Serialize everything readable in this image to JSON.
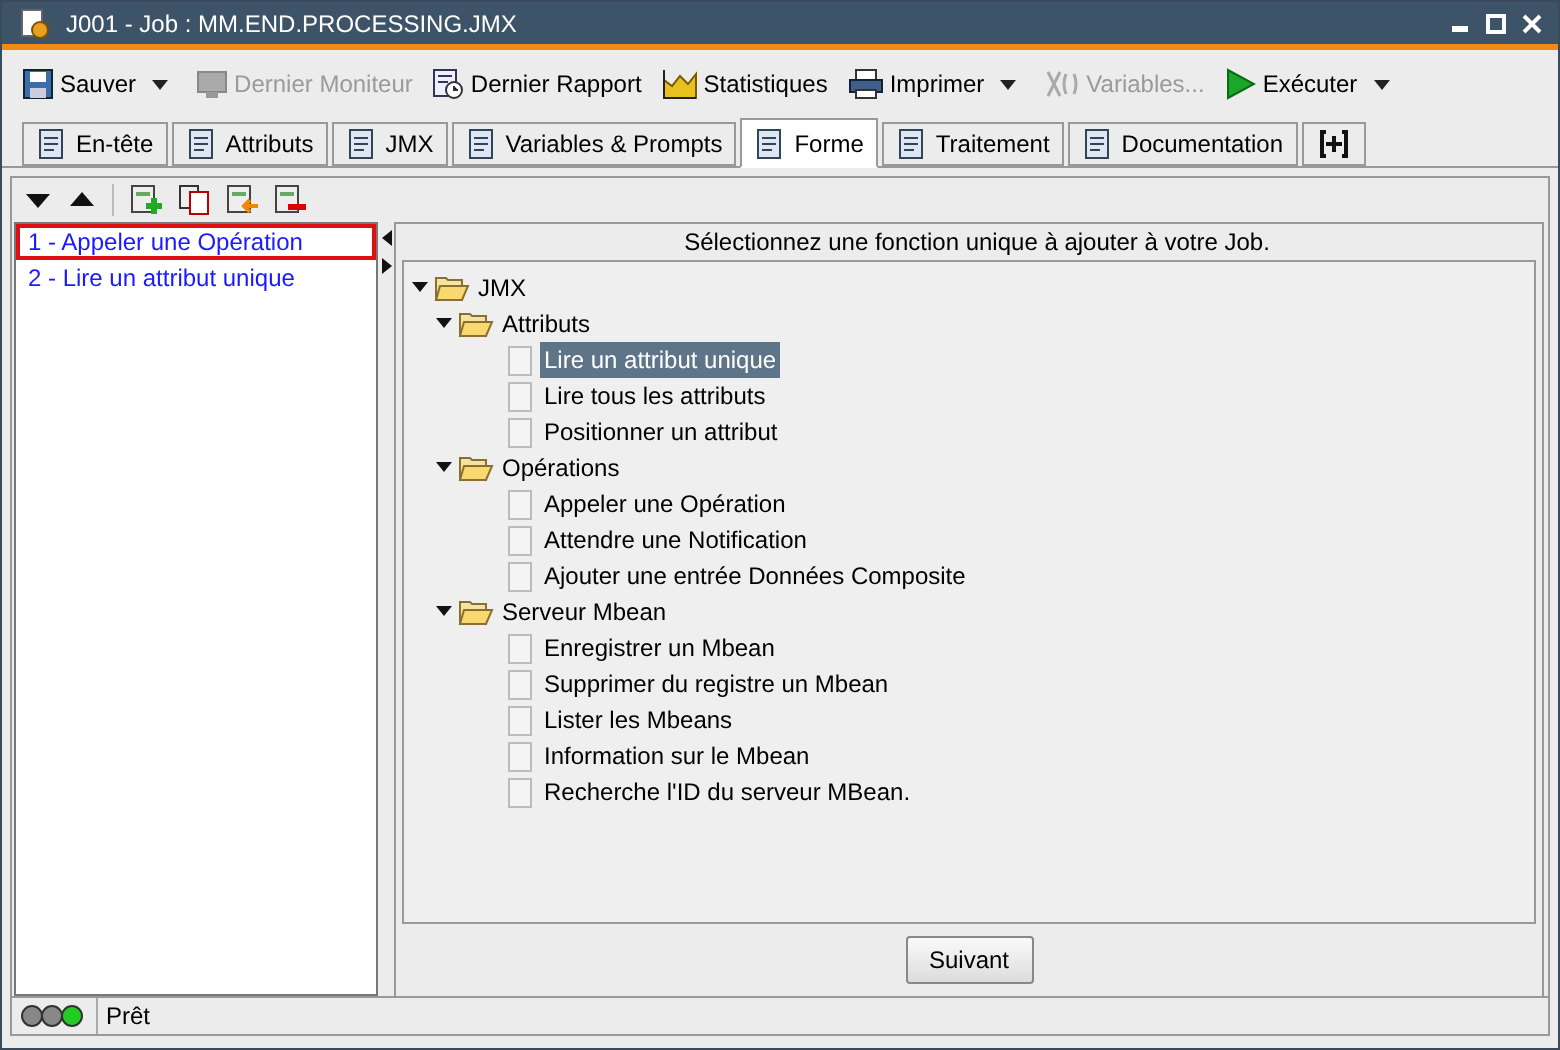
{
  "window": {
    "title": "J001 - Job : MM.END.PROCESSING.JMX"
  },
  "toolbar": [
    {
      "label": "Sauver",
      "disabled": false,
      "dropdown": true
    },
    {
      "label": "Dernier Moniteur",
      "disabled": true,
      "dropdown": false
    },
    {
      "label": "Dernier Rapport",
      "disabled": false,
      "dropdown": false
    },
    {
      "label": "Statistiques",
      "disabled": false,
      "dropdown": false
    },
    {
      "label": "Imprimer",
      "disabled": false,
      "dropdown": true
    },
    {
      "label": "Variables...",
      "disabled": true,
      "dropdown": false
    },
    {
      "label": "Exécuter",
      "disabled": false,
      "dropdown": true
    }
  ],
  "tabs": [
    {
      "label": "En-tête",
      "selected": false
    },
    {
      "label": "Attributs",
      "selected": false
    },
    {
      "label": "JMX",
      "selected": false
    },
    {
      "label": "Variables & Prompts",
      "selected": false
    },
    {
      "label": "Forme",
      "selected": true
    },
    {
      "label": "Traitement",
      "selected": false
    },
    {
      "label": "Documentation",
      "selected": false
    }
  ],
  "steps": [
    {
      "label": "1 - Appeler une Opération",
      "selected": true
    },
    {
      "label": "2 - Lire un attribut unique",
      "selected": false
    }
  ],
  "prompt": "Sélectionnez une fonction unique à ajouter à votre Job.",
  "tree": {
    "label": "JMX",
    "expanded": true,
    "children": [
      {
        "label": "Attributs",
        "expanded": true,
        "children": [
          {
            "label": "Lire un attribut unique",
            "selected": true
          },
          {
            "label": "Lire tous les attributs",
            "selected": false
          },
          {
            "label": "Positionner un attribut",
            "selected": false
          }
        ]
      },
      {
        "label": "Opérations",
        "expanded": true,
        "children": [
          {
            "label": "Appeler une Opération",
            "selected": false
          },
          {
            "label": "Attendre une Notification",
            "selected": false
          },
          {
            "label": "Ajouter une entrée Données Composite",
            "selected": false
          }
        ]
      },
      {
        "label": "Serveur Mbean",
        "expanded": true,
        "children": [
          {
            "label": "Enregistrer un Mbean",
            "selected": false
          },
          {
            "label": "Supprimer du registre un Mbean",
            "selected": false
          },
          {
            "label": "Lister les Mbeans",
            "selected": false
          },
          {
            "label": "Information sur le Mbean",
            "selected": false
          },
          {
            "label": "Recherche l'ID du serveur MBean.",
            "selected": false
          }
        ]
      }
    ]
  },
  "next_button": "Suivant",
  "status_bar": {
    "text": "Prêt"
  }
}
